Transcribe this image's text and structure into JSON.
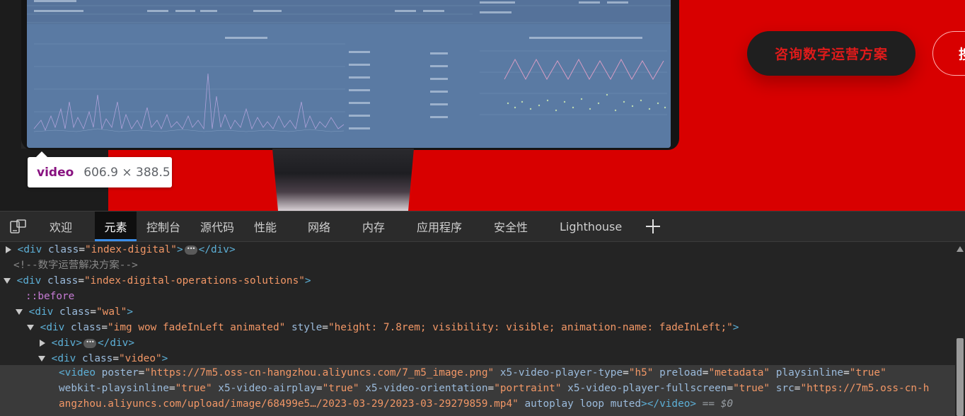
{
  "page": {
    "cta_primary": "咨询数字运营方案",
    "cta_secondary_partial": "搜"
  },
  "tooltip": {
    "tag": "video",
    "size": "606.9 × 388.5"
  },
  "devtools": {
    "tabs": [
      "欢迎",
      "元素",
      "控制台",
      "源代码",
      "性能",
      "网络",
      "内存",
      "应用程序",
      "安全性",
      "Lighthouse"
    ],
    "active_tab": "元素",
    "dom": {
      "l1": {
        "tag": "div",
        "attr": "class",
        "val": "\"index-digital\""
      },
      "comment": "<!--数字运营解决方案-->",
      "l3": {
        "tag": "div",
        "attr": "class",
        "val": "\"index-digital-operations-solutions\""
      },
      "before": "::before",
      "l5": {
        "tag": "div",
        "attr": "class",
        "val": "\"wal\""
      },
      "l6": {
        "tag": "div",
        "attr1": "class",
        "val1": "\"img wow fadeInLeft animated\"",
        "attr2": "style",
        "val2": "\"height: 7.8rem; visibility: visible; animation-name: fadeInLeft;\""
      },
      "l7_tag": "div",
      "l8": {
        "tag": "div",
        "attr": "class",
        "val": "\"video\""
      },
      "video": {
        "tag": "video",
        "poster_attr": "poster",
        "poster_val": "\"https://7m5.oss-cn-hangzhou.aliyuncs.com/7_m5_image.png\"",
        "x5type_attr": "x5-video-player-type",
        "x5type_val": "\"h5\"",
        "preload_attr": "preload",
        "preload_val": "\"metadata\"",
        "playsinline_attr": "playsinline",
        "playsinline_val": "\"true\"",
        "wkpi_attr": "webkit-playsinline",
        "wkpi_val": "\"true\"",
        "x5air_attr": "x5-video-airplay",
        "x5air_val": "\"true\"",
        "x5orient_attr": "x5-video-orientation",
        "x5orient_val": "\"portraint\"",
        "x5full_attr": "x5-video-player-fullscreen",
        "x5full_val": "\"true\"",
        "src_attr": "src",
        "src_val_1": "\"https://7m5.oss-cn-h",
        "src_val_2": "angzhou.aliyuncs.com/upload/image/68499e5…/2023-03-29/2023-03-29279859.mp4\"",
        "flags": "autoplay loop muted",
        "eq": "== $0"
      }
    }
  }
}
